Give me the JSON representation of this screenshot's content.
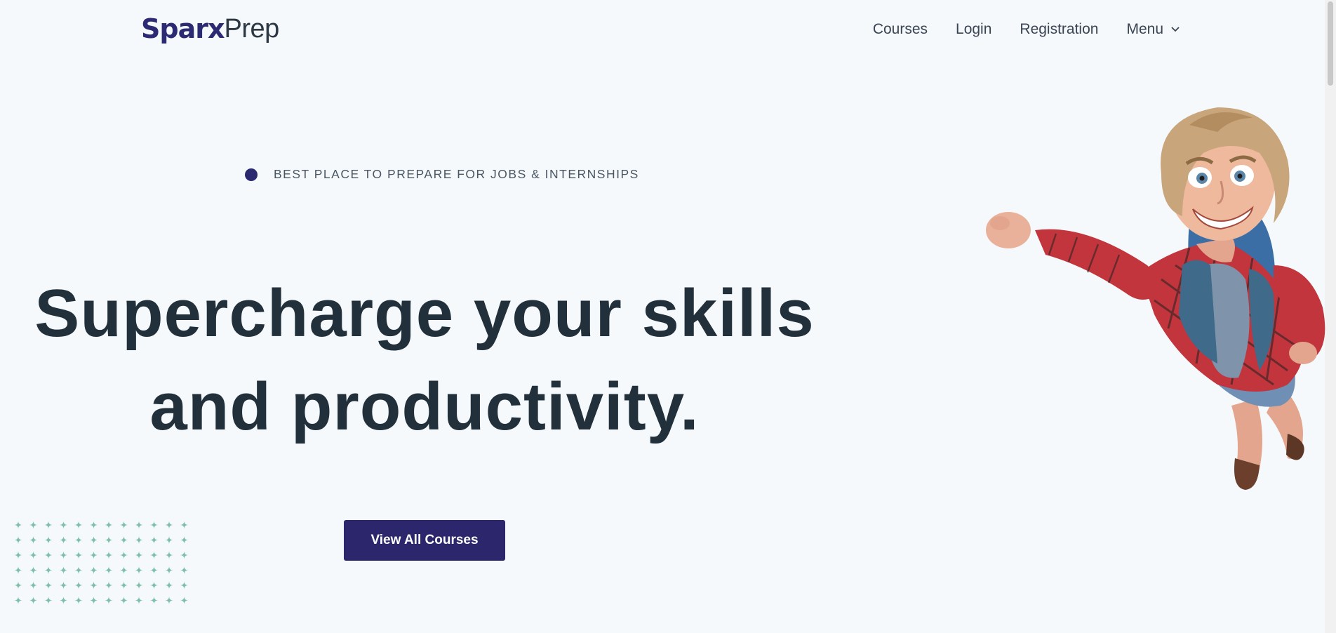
{
  "header": {
    "logo": {
      "bold": "Sparx",
      "light": "Prep"
    },
    "nav": [
      {
        "label": "Courses"
      },
      {
        "label": "Login"
      },
      {
        "label": "Registration"
      },
      {
        "label": "Menu"
      }
    ]
  },
  "hero": {
    "tagline": "BEST PLACE TO PREPARE FOR JOBS & INTERNSHIPS",
    "headline_line1": "Supercharge your skills",
    "headline_line2": "and productivity.",
    "cta_label": "View All Courses"
  },
  "colors": {
    "background": "#f5f9fc",
    "brand": "#2c276d",
    "text": "#21303a",
    "sparkle": "#7dbfa8"
  },
  "icons": {
    "menu_chevron": "chevron-down-icon",
    "tagline_dot": "dot-icon",
    "decor": "sparkle-grid",
    "illustration": "flying-boy-illustration"
  }
}
